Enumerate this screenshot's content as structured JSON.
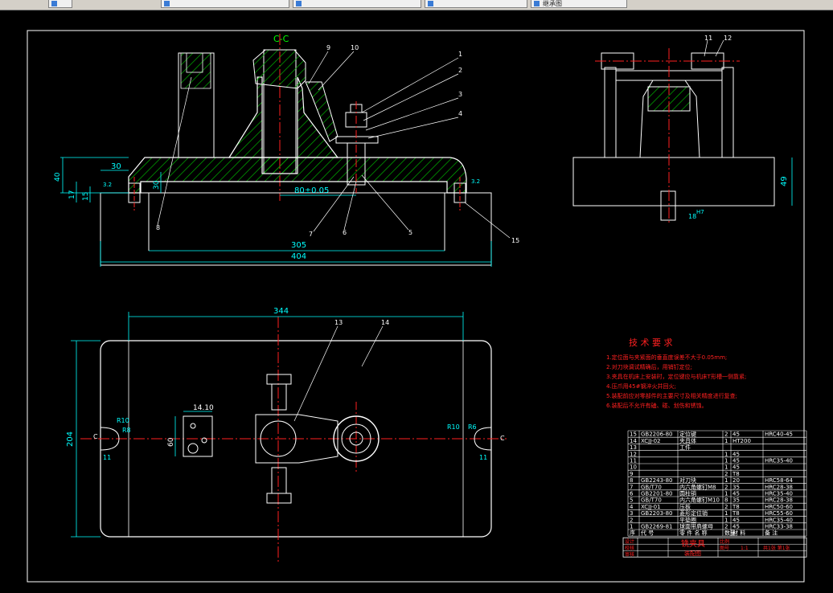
{
  "app": {
    "tabs": [
      {
        "label": ""
      },
      {
        "label": ""
      },
      {
        "label": ""
      },
      {
        "label": ""
      },
      {
        "label": "继承图"
      }
    ]
  },
  "colors": {
    "background": "#000000",
    "border": "#ffffff",
    "dimension": "#00ffff",
    "center_line": "#ff2020",
    "hatch": "#00c000",
    "note_text": "#ff2020",
    "outline": "#ffffff"
  },
  "drawing": {
    "section_label": "C-C",
    "dims": {
      "d30_top": "30",
      "d40": "40",
      "d17": "17",
      "d15": "15",
      "d30_v": "30",
      "d80": "80±0.05",
      "d305": "305",
      "d404": "404",
      "d344": "344",
      "d204": "204",
      "d49": "49",
      "d18": "18",
      "d18_fit": "H7",
      "d14": "14.10",
      "d60": "60",
      "r10_l": "R10",
      "r8_l": "R8",
      "r10_r": "R10",
      "r6_r": "R6",
      "d11_l": "11",
      "d11_r": "11",
      "c_l": "C",
      "c_r": "C",
      "rough_l": "3.2",
      "rough_r": "3.2"
    },
    "callouts": [
      "1",
      "2",
      "3",
      "4",
      "5",
      "6",
      "7",
      "8",
      "9",
      "10",
      "11",
      "12",
      "13",
      "14",
      "15"
    ]
  },
  "notes": {
    "title": "技 术 要 求",
    "items": [
      "1.定位面与夹紧面的垂直度误差不大于0.05mm;",
      "2.对刀块调试精确后，用销钉定位;",
      "3.夹具在机床上安装时，定位键应与机床T形槽一侧靠紧;",
      "4.压爪用45#钢淬火并回火;",
      "5.装配前应对零部件的主要尺寸及相关精度进行复查;",
      "6.装配后不允许有磕、碰、划伤和锈蚀。"
    ]
  },
  "bom": {
    "rows": [
      {
        "no": "15",
        "code": "GB2206-80",
        "name": "定位键",
        "qty": "2",
        "mat": "45",
        "note": "HRC40-45"
      },
      {
        "no": "14",
        "code": "XCJJ-02",
        "name": "夹具体",
        "qty": "1",
        "mat": "HT200",
        "note": ""
      },
      {
        "no": "13",
        "code": "",
        "name": "工件",
        "qty": "",
        "mat": "",
        "note": ""
      },
      {
        "no": "12",
        "code": "",
        "name": "",
        "qty": "1",
        "mat": "45",
        "note": ""
      },
      {
        "no": "11",
        "code": "",
        "name": "",
        "qty": "1",
        "mat": "45",
        "note": "HRC35-40"
      },
      {
        "no": "10",
        "code": "",
        "name": "",
        "qty": "1",
        "mat": "45",
        "note": ""
      },
      {
        "no": "9",
        "code": "",
        "name": "",
        "qty": "2",
        "mat": "T8",
        "note": ""
      },
      {
        "no": "8",
        "code": "GB2243-80",
        "name": "对刀块",
        "qty": "1",
        "mat": "20",
        "note": "HRC58-64"
      },
      {
        "no": "7",
        "code": "GB/T70",
        "name": "内六角螺钉M8",
        "qty": "2",
        "mat": "35",
        "note": "HRC28-38"
      },
      {
        "no": "6",
        "code": "GB2201-80",
        "name": "圆柱销",
        "qty": "1",
        "mat": "45",
        "note": "HRC35-40"
      },
      {
        "no": "5",
        "code": "GB/T70",
        "name": "内六角螺钉M10",
        "qty": "8",
        "mat": "35",
        "note": "HRC28-38"
      },
      {
        "no": "4",
        "code": "XCJJ-01",
        "name": "压板",
        "qty": "2",
        "mat": "T8",
        "note": "HRC50-60"
      },
      {
        "no": "3",
        "code": "GB2203-80",
        "name": "菱形定位销",
        "qty": "1",
        "mat": "T8",
        "note": "HRC55-60"
      },
      {
        "no": "2",
        "code": "",
        "name": "平垫圈",
        "qty": "1",
        "mat": "45",
        "note": "HRC35-40"
      },
      {
        "no": "1",
        "code": "GB2269-81",
        "name": "球面带肩螺母",
        "qty": "2",
        "mat": "45",
        "note": "HRC33-38"
      }
    ],
    "header": {
      "no": "序",
      "code": "代 号",
      "name": "零 件 名 称",
      "qty": "数量",
      "mat": "材 料",
      "note": "备 注"
    },
    "title_block": {
      "name": "铣夹具",
      "subtitle": "装配图",
      "left1": "设计",
      "left2": "校核",
      "left3": "审核",
      "r1": "比例",
      "r2": "图号",
      "r3": "1:1",
      "r4": "共1张 第1张"
    }
  }
}
